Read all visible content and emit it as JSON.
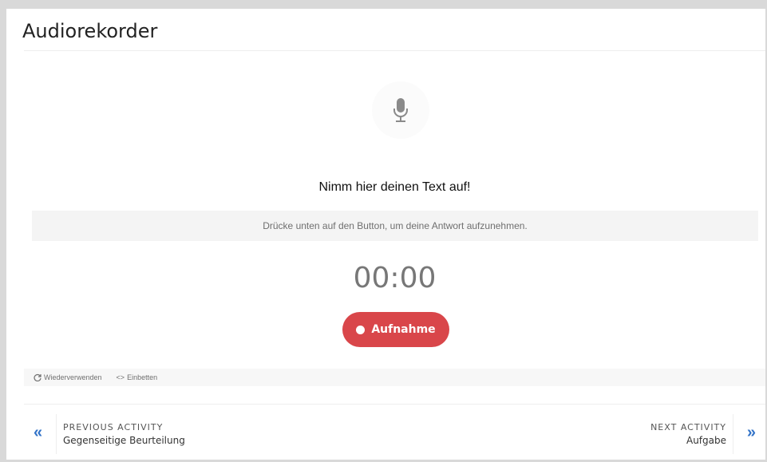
{
  "page": {
    "title": "Audiorekorder"
  },
  "recorder": {
    "icon": "microphone-icon",
    "title": "Nimm hier deinen Text auf!",
    "hint": "Drücke unten auf den Button, um deine Antwort aufzunehmen.",
    "timer": "00:00",
    "record_label": "Aufnahme",
    "record_color": "#d9464a"
  },
  "footer": {
    "reuse_label": "Wiederverwenden",
    "embed_label": "Einbetten"
  },
  "navigation": {
    "prev_label": "PREVIOUS ACTIVITY",
    "prev_name": "Gegenseitige Beurteilung",
    "next_label": "NEXT ACTIVITY",
    "next_name": "Aufgabe",
    "arrow_color": "#3273c8"
  }
}
